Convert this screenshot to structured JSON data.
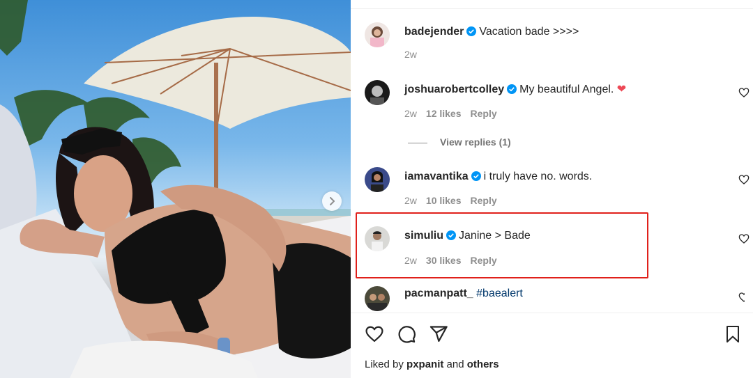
{
  "post": {
    "caption": {
      "username": "badejender",
      "text": "Vacation bade >>>>",
      "time": "2w"
    },
    "comments": [
      {
        "username": "joshuarobertcolley",
        "text": "My beautiful Angel. ",
        "emoji": "❤",
        "time": "2w",
        "likes": "12 likes",
        "reply": "Reply",
        "view_replies": "View replies (1)"
      },
      {
        "username": "iamavantika",
        "text": "i truly have no. words.",
        "time": "2w",
        "likes": "10 likes",
        "reply": "Reply"
      },
      {
        "username": "simuliu",
        "text": "Janine > Bade",
        "time": "2w",
        "likes": "30 likes",
        "reply": "Reply"
      },
      {
        "username": "pacmanpatt_",
        "text": "#baealert"
      }
    ],
    "liked_by": {
      "prefix": "Liked by ",
      "user": "pxpanit",
      "middle": " and ",
      "others": "others"
    }
  },
  "colors": {
    "verified": "#0095f6",
    "highlight": "#e0201a",
    "heart": "#ed4956"
  },
  "icons": [
    "chevron-right-icon",
    "verified-icon",
    "heart-icon",
    "comment-icon",
    "share-icon",
    "bookmark-icon"
  ]
}
